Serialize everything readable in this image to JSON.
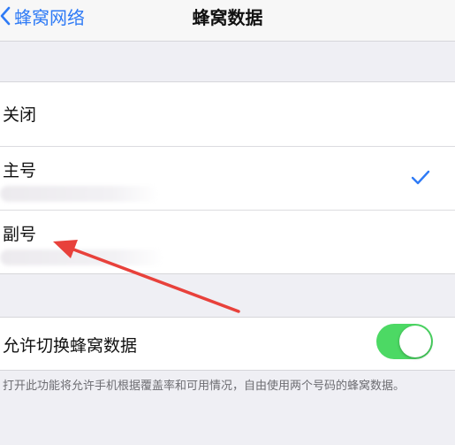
{
  "navbar": {
    "back_label": "蜂窝网络",
    "title": "蜂窝数据"
  },
  "options": {
    "items": [
      {
        "label": "关闭",
        "selected": false
      },
      {
        "label": "主号",
        "selected": true
      },
      {
        "label": "副号",
        "selected": false
      }
    ]
  },
  "allow_switch": {
    "label": "允许切换蜂窝数据",
    "enabled": true
  },
  "footnote": "打开此功能将允许手机根据覆盖率和可用情况，自由使用两个号码的蜂窝数据。",
  "colors": {
    "accent": "#2f7bf6",
    "toggle_on": "#4cd964",
    "annotation_arrow": "#e8413b"
  }
}
